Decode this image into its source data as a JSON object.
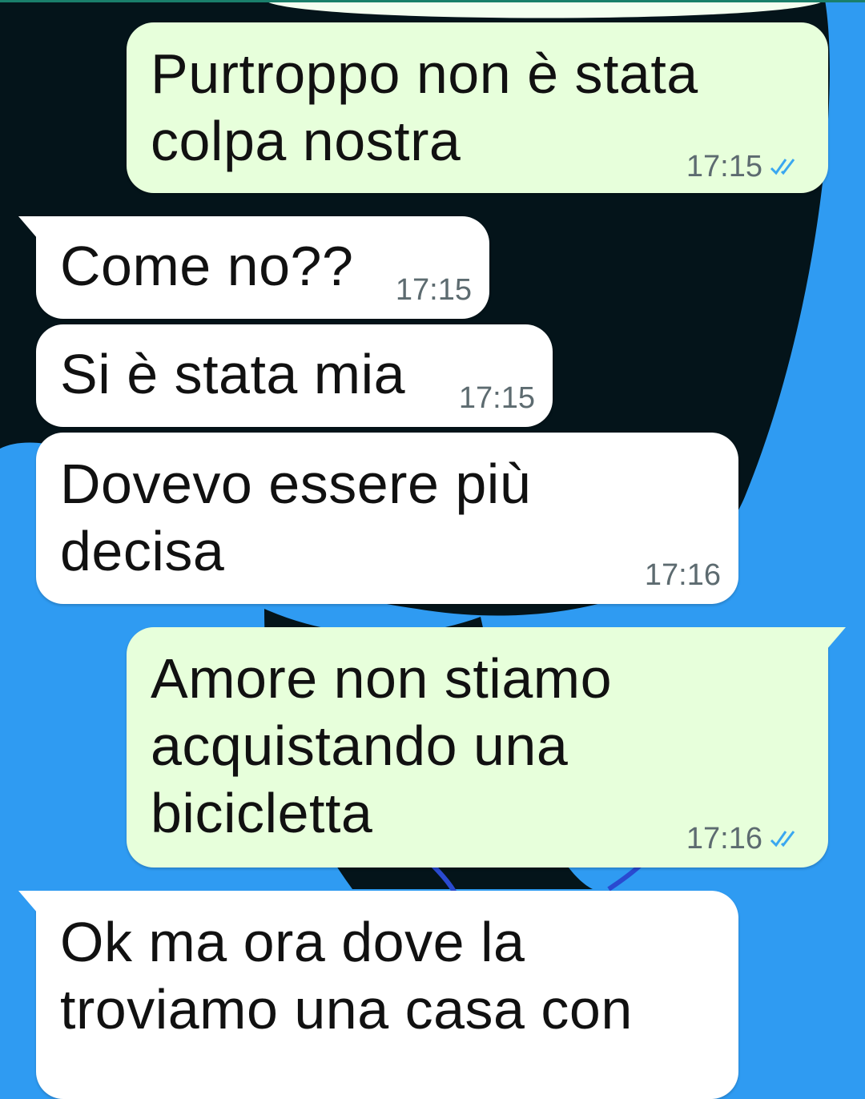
{
  "messages": [
    {
      "direction": "outgoing",
      "text": "Purtroppo non è stata\ncolpa nostra",
      "time": "17:15",
      "status_icon": "double-check-read-icon"
    },
    {
      "direction": "incoming",
      "text": "Come no??",
      "time": "17:15"
    },
    {
      "direction": "incoming",
      "text": "Si è stata mia",
      "time": "17:15"
    },
    {
      "direction": "incoming",
      "text": "Dovevo essere più\ndecisa",
      "time": "17:16"
    },
    {
      "direction": "outgoing",
      "text": "Amore non stiamo\nacquistando una\nbicicletta",
      "time": "17:16",
      "status_icon": "double-check-read-icon"
    },
    {
      "direction": "incoming",
      "text": "Ok ma ora dove la\ntroviamo una casa con"
    }
  ],
  "colors": {
    "background": "#2f9bf2",
    "wallpaper_dark": "#04141a",
    "outgoing_bubble": "#e7ffdb",
    "incoming_bubble": "#ffffff",
    "read_tick": "#3aa7f0"
  }
}
